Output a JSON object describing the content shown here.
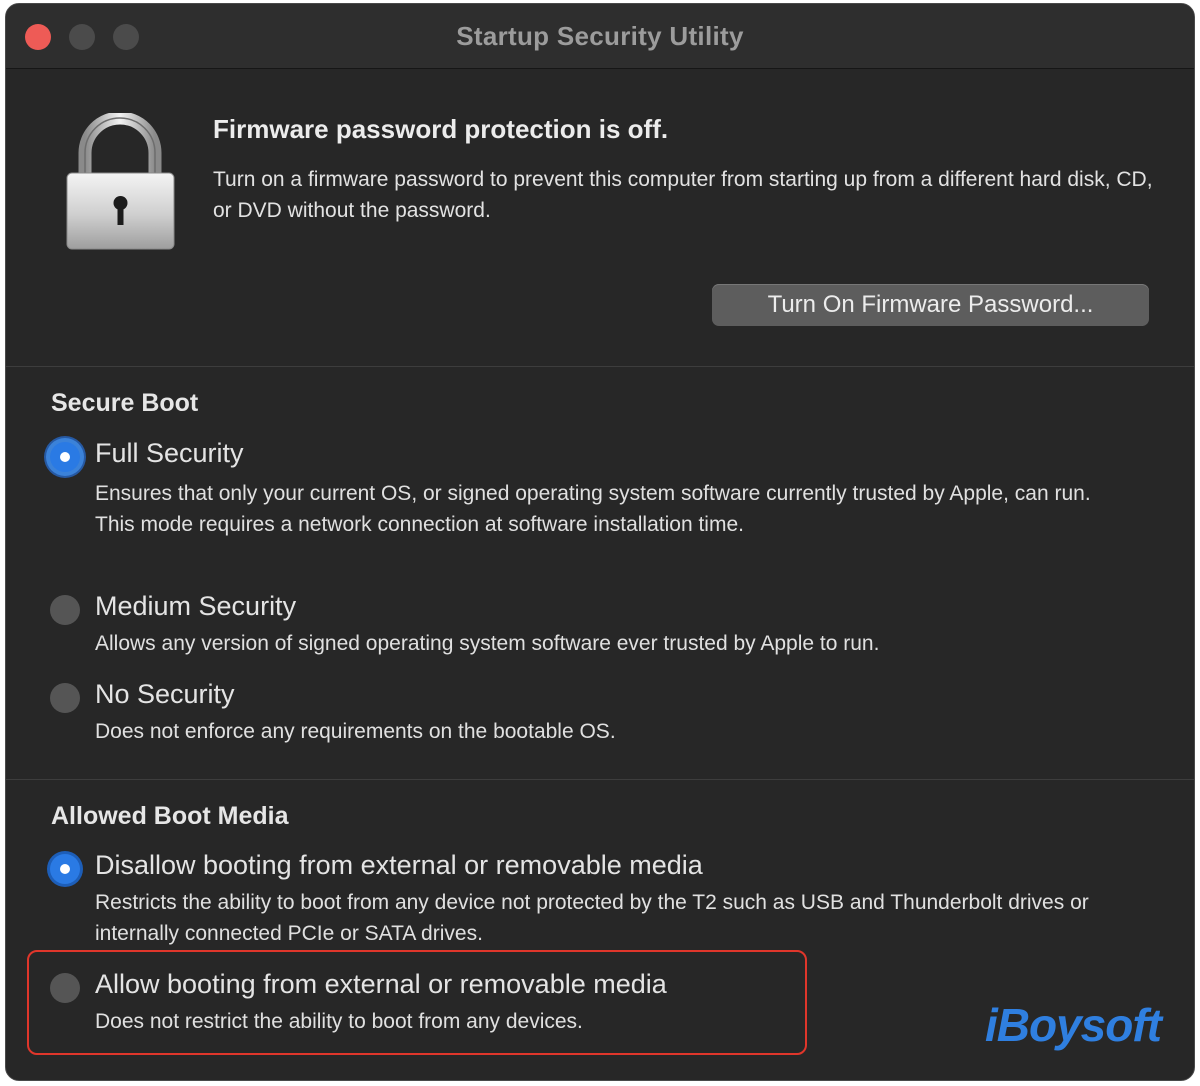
{
  "window": {
    "title": "Startup Security Utility"
  },
  "firmware": {
    "heading": "Firmware password protection is off.",
    "description": "Turn on a firmware password to prevent this computer from starting up from a different hard disk, CD, or DVD without the password.",
    "button_label": "Turn On Firmware Password...",
    "icon": "padlock-icon"
  },
  "secure_boot": {
    "heading": "Secure Boot",
    "options": [
      {
        "label": "Full Security",
        "description": "Ensures that only your current OS, or signed operating system software currently trusted by Apple, can run. This mode requires a network connection at software installation time.",
        "selected": true
      },
      {
        "label": "Medium Security",
        "description": "Allows any version of signed operating system software ever trusted by Apple to run.",
        "selected": false
      },
      {
        "label": "No Security",
        "description": "Does not enforce any requirements on the bootable OS.",
        "selected": false
      }
    ]
  },
  "boot_media": {
    "heading": "Allowed Boot Media",
    "options": [
      {
        "label": "Disallow booting from external or removable media",
        "description": "Restricts the ability to boot from any device not protected by the T2 such as USB and Thunderbolt drives or internally connected PCIe or SATA drives.",
        "selected": true
      },
      {
        "label": "Allow booting from external or removable media",
        "description": "Does not restrict the ability to boot from any devices.",
        "selected": false
      }
    ]
  },
  "watermark": "iBoysoft",
  "colors": {
    "accent": "#2a7ae4",
    "highlight_border": "#e0362b",
    "window_bg": "#272727",
    "close_button": "#ee5b56"
  }
}
